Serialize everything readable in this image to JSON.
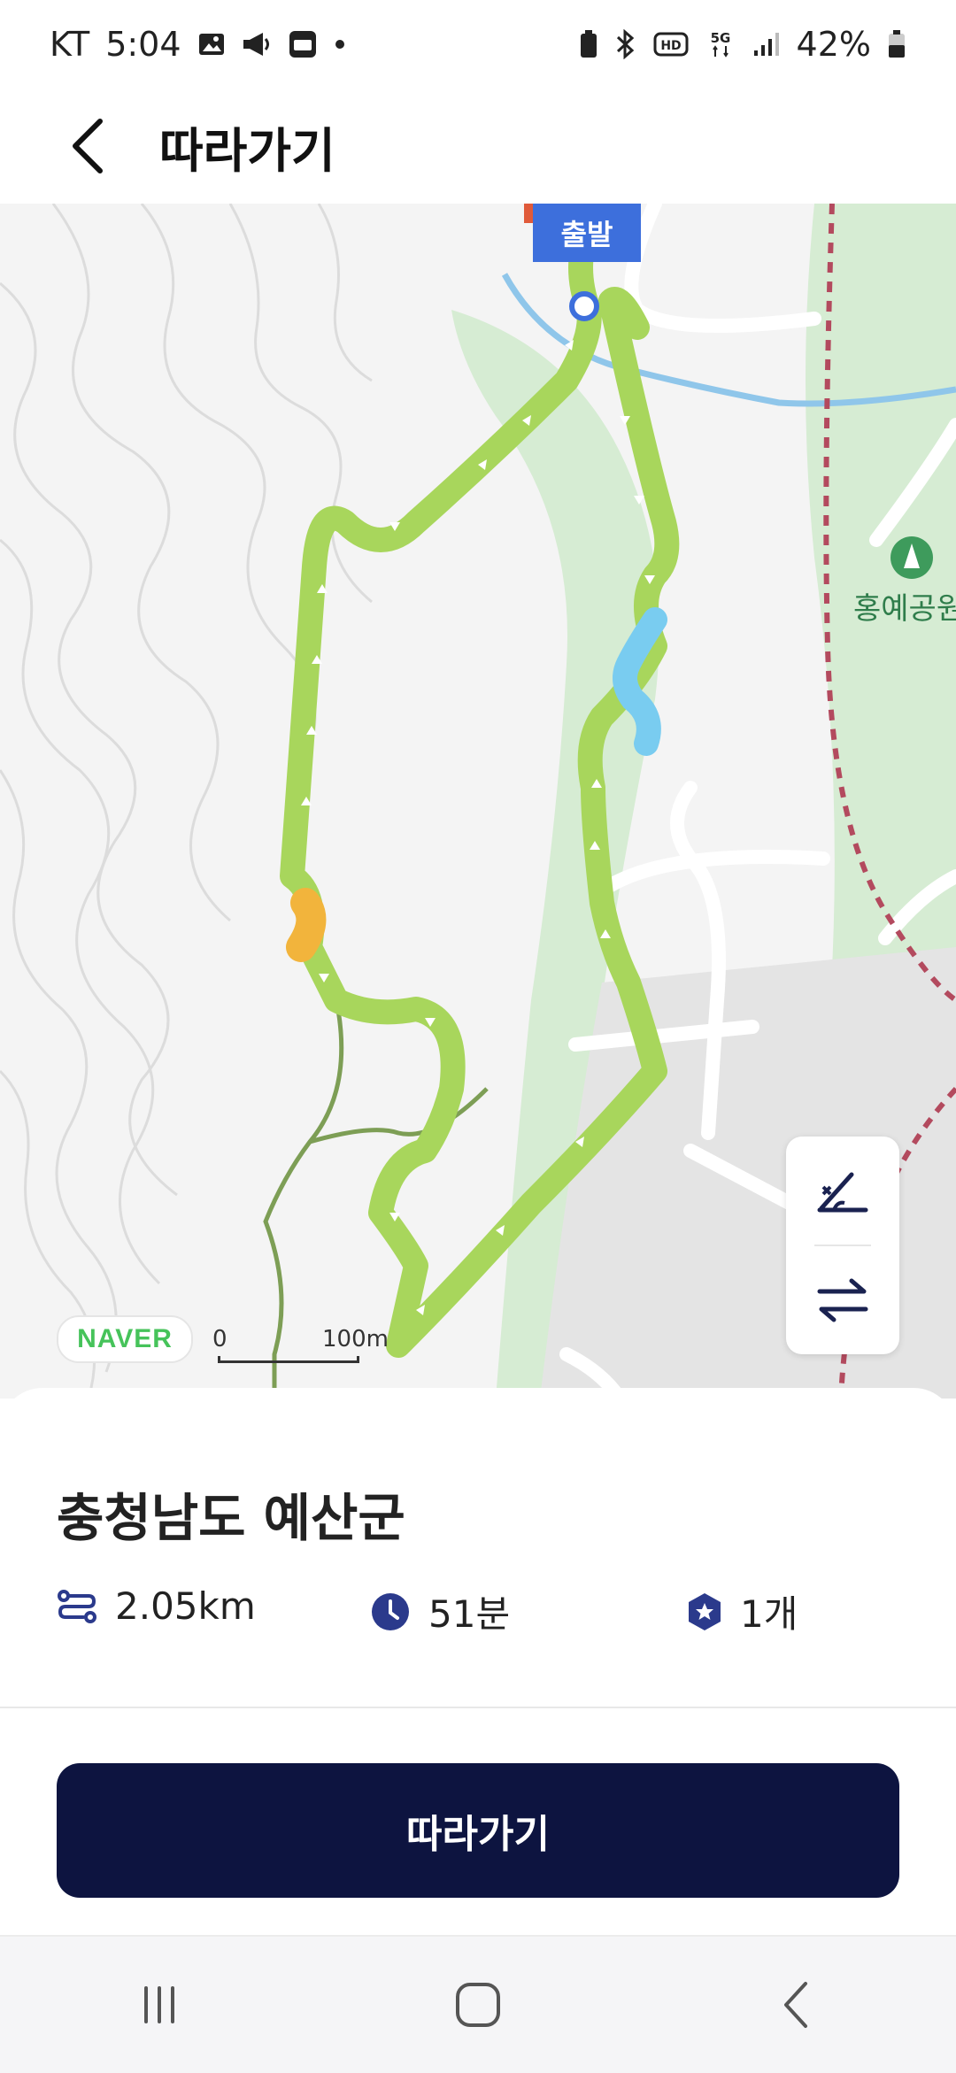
{
  "status_bar": {
    "carrier": "KT",
    "time": "5:04",
    "battery": "42%",
    "left_icons": [
      "image-icon",
      "megaphone-icon",
      "pay-icon",
      "dot-icon"
    ],
    "right_icons": [
      "battery-saver-icon",
      "bluetooth-icon",
      "hd-icon",
      "5g-icon",
      "signal-icon",
      "battery-icon"
    ]
  },
  "header": {
    "title": "따라가기",
    "back_icon": "chevron-left-icon"
  },
  "map": {
    "start_label": "출발",
    "park_label": "홍예공원",
    "naver_badge": "NAVER",
    "scale": {
      "zero": "0",
      "distance": "100m"
    },
    "controls": [
      "elevation-toggle-icon",
      "swap-direction-icon"
    ],
    "colors": {
      "route": "#a8d65c",
      "route_water": "#79ccf0",
      "route_warning": "#f2b43c",
      "trail": "#7d9e55",
      "park": "#d6ecd3",
      "start_marker": "#3d6fdc",
      "boundary": "#b34a5e"
    }
  },
  "route_info": {
    "region": "충청남도 예산군",
    "distance": "2.05km",
    "time": "51분",
    "count": "1개",
    "icons": [
      "route-distance-icon",
      "clock-icon",
      "badge-star-icon"
    ]
  },
  "actions": {
    "follow_button": "따라가기"
  },
  "nav_bar": {
    "items": [
      "recent-apps-icon",
      "home-icon",
      "back-icon"
    ]
  }
}
